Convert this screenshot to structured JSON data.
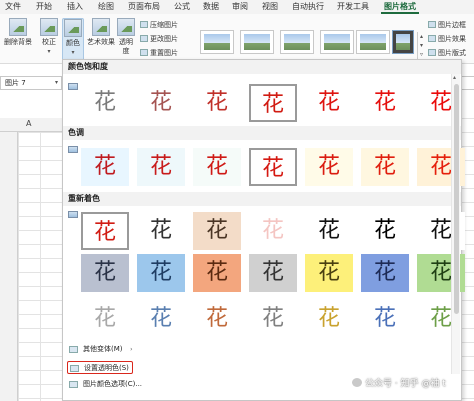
{
  "tabs": [
    {
      "label": "文件"
    },
    {
      "label": "开始"
    },
    {
      "label": "插入"
    },
    {
      "label": "绘图"
    },
    {
      "label": "页面布局"
    },
    {
      "label": "公式"
    },
    {
      "label": "数据"
    },
    {
      "label": "审阅"
    },
    {
      "label": "视图"
    },
    {
      "label": "自动执行"
    },
    {
      "label": "开发工具"
    },
    {
      "label": "图片格式"
    }
  ],
  "active_tab": "图片格式",
  "ribbon": {
    "remove_bg": "删除背景",
    "correct": "校正",
    "color": "颜色",
    "art_effects": "艺术效果",
    "transparency_1": "透明",
    "transparency_2": "度",
    "compress": "压缩图片",
    "change": "更改图片",
    "reset": "重置图片",
    "border": "图片边框",
    "effects": "图片效果",
    "layout": "图片版式"
  },
  "name_box": "图片 7",
  "column_header": "A",
  "panel": {
    "sections": {
      "saturation": "颜色饱和度",
      "tone": "色调",
      "recolor": "重新着色"
    },
    "glyph": "花",
    "saturation_colors": [
      "#7a7a7a",
      "#a55452",
      "#c0302a",
      "#d11b12",
      "#de1410",
      "#e50f0d",
      "#ea0b0b"
    ],
    "tone_colors": [
      "#bf1b20",
      "#c81b1b",
      "#cf1a16",
      "#d51912",
      "#da1c10",
      "#e01e0e",
      "#e5200c"
    ],
    "tone_bgs": [
      "#e8f6ff",
      "#eef8fb",
      "#f5fbf9",
      "#ffffff",
      "#fffbe8",
      "#fff7e0",
      "#fff2d8"
    ],
    "recolor_row1_colors": [
      "#d11b12",
      "#333333",
      "#4a3525",
      "#f4c5c2",
      "#111111",
      "#000000",
      "#111111"
    ],
    "recolor_row1_bgs": [
      "#ffffff",
      "#ffffff",
      "#f3dcc8",
      "#ffffff",
      "#ffffff",
      "#ffffff",
      "#ffffff"
    ],
    "recolor_row2_colors": [
      "#2a3246",
      "#1f3d63",
      "#5b2a10",
      "#333333",
      "#4a4010",
      "#1d2a55",
      "#1f3f14"
    ],
    "recolor_row2_bgs": [
      "#b9c0d0",
      "#9cc7ec",
      "#f3a67e",
      "#d0d0d0",
      "#fdf07a",
      "#7f9ee0",
      "#b0dc93"
    ],
    "recolor_row3_colors": [
      "#a8a8a8",
      "#5a7fb0",
      "#c0693a",
      "#808080",
      "#c9a22e",
      "#4a70b8",
      "#6d9f48"
    ],
    "menu": {
      "more_variations": "其他变体(M)",
      "set_transparent": "设置透明色(S)",
      "picture_color_options": "图片颜色选项(C)..."
    }
  },
  "watermark": "公众号 · 知乎 @袖 t"
}
